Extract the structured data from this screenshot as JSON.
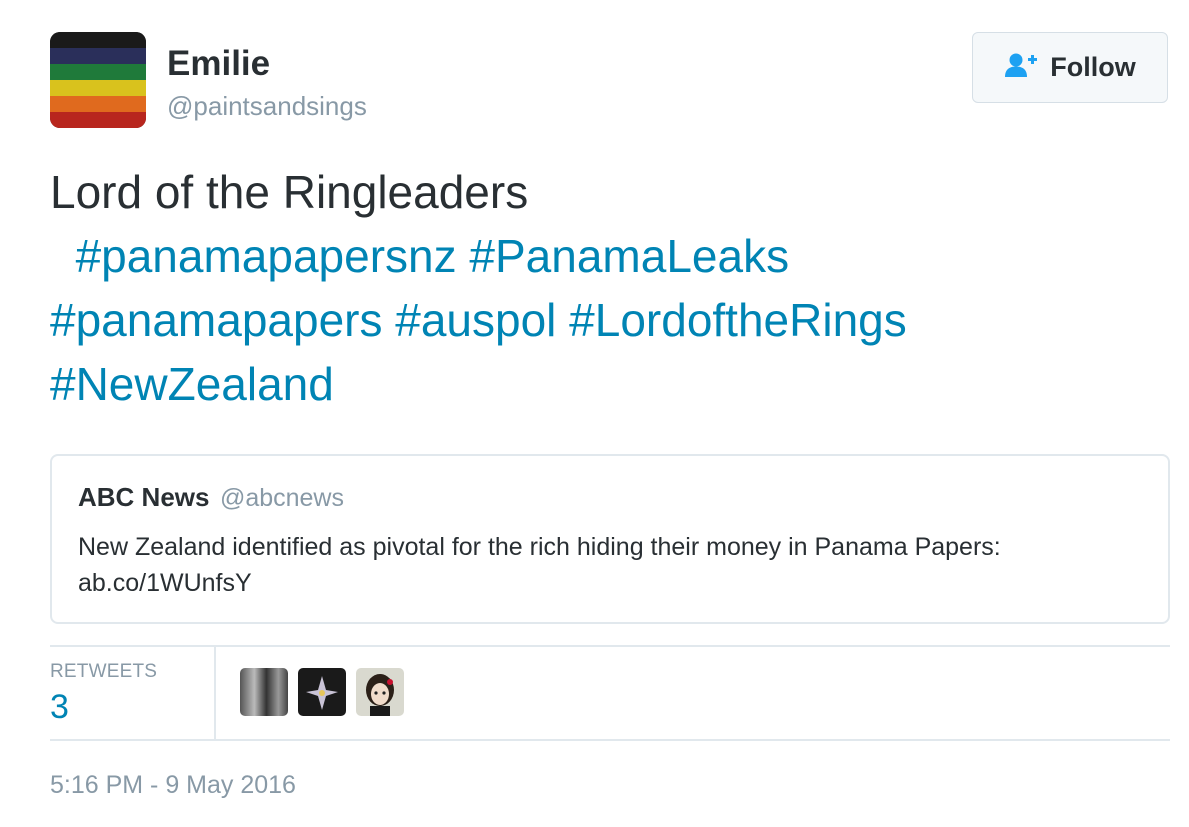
{
  "author": {
    "name": "Emilie",
    "handle": "@paintsandsings"
  },
  "follow_button": {
    "label": "Follow",
    "icon": "follow-user-plus-icon"
  },
  "tweet": {
    "text": "Lord of the Ringleaders",
    "hashtags": [
      "#panamapapersnz",
      "#PanamaLeaks",
      "#panamapapers",
      "#auspol",
      "#LordoftheRings",
      "#NewZealand"
    ]
  },
  "quoted_tweet": {
    "name": "ABC News",
    "handle": "@abcnews",
    "text": "New Zealand identified as pivotal for the rich hiding their money in Panama Papers:",
    "link": "ab.co/1WUnfsY"
  },
  "stats": {
    "retweets_label": "RETWEETS",
    "retweets_count": "3"
  },
  "timestamp": "5:16 PM - 9 May 2016",
  "colors": {
    "link": "#0084b4",
    "text": "#292f33",
    "muted": "#8899a6",
    "border": "#e1e8ed"
  }
}
